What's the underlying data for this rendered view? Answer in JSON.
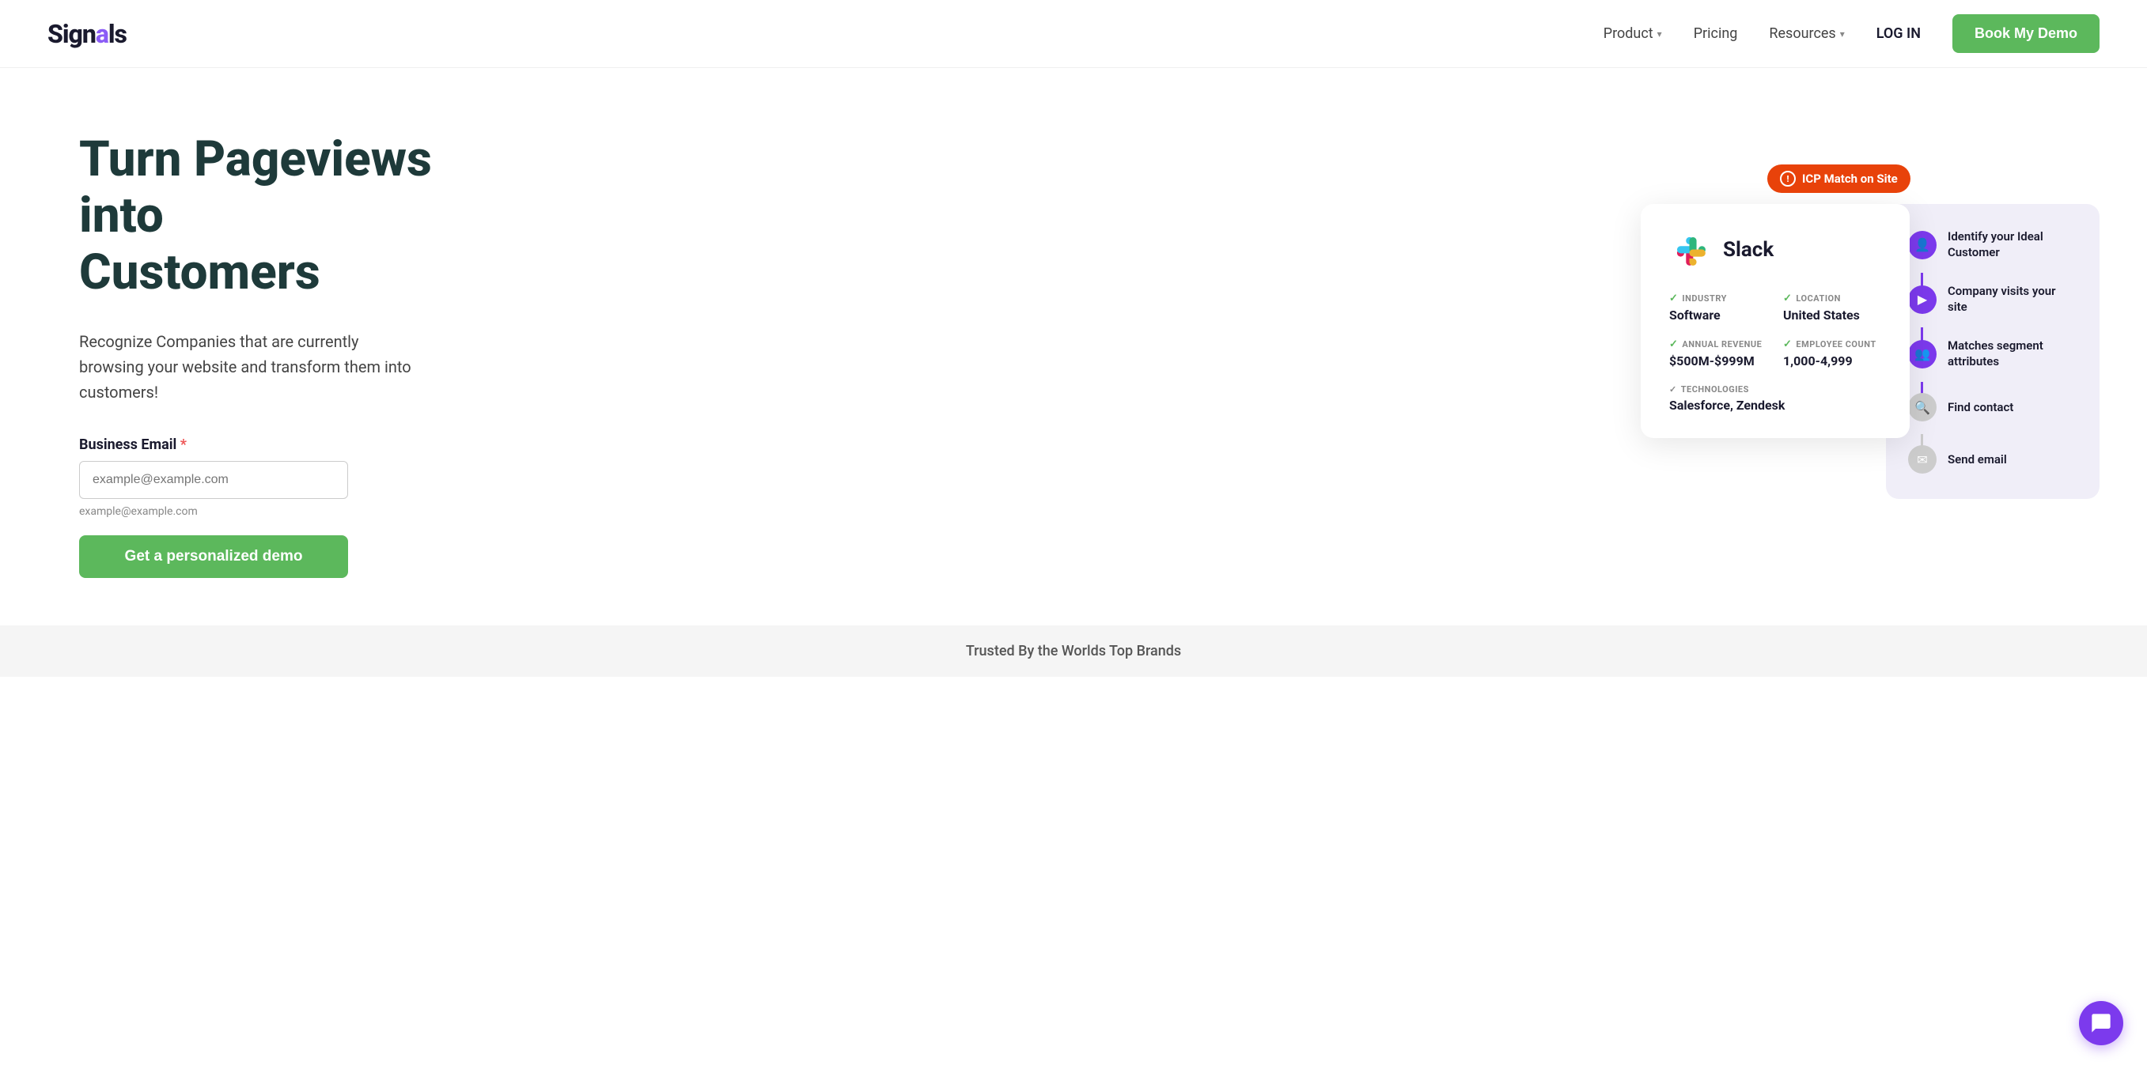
{
  "logo": {
    "text_before": "Sign",
    "text_highlight": "a",
    "text_after": "ls"
  },
  "nav": {
    "product_label": "Product",
    "pricing_label": "Pricing",
    "resources_label": "Resources",
    "login_label": "LOG IN",
    "cta_label": "Book My Demo"
  },
  "hero": {
    "heading_line1": "Turn Pageviews into",
    "heading_line2": "Customers",
    "subtext": "Recognize Companies that are currently browsing your website and transform them into customers!",
    "email_label": "Business Email",
    "email_required": "*",
    "email_placeholder": "example@example.com",
    "cta_label": "Get a personalized demo"
  },
  "icp_badge": {
    "label": "ICP Match on Site"
  },
  "company_card": {
    "name": "Slack",
    "industry_label": "INDUSTRY",
    "industry_val": "Software",
    "location_label": "LOCATION",
    "location_val": "United States",
    "revenue_label": "ANNUAL REVENUE",
    "revenue_val": "$500M-$999M",
    "employees_label": "EMPLOYEE COUNT",
    "employees_val": "1,000-4,999",
    "tech_label": "TECHNOLOGIES",
    "tech_val": "Salesforce, Zendesk"
  },
  "steps": [
    {
      "label": "Identify your Ideal Customer",
      "active": true,
      "icon": "👤"
    },
    {
      "label": "Company visits your site",
      "active": true,
      "icon": "▶"
    },
    {
      "label": "Matches segment attributes",
      "active": true,
      "icon": "👥"
    },
    {
      "label": "Find contact",
      "active": false,
      "icon": "🔍"
    },
    {
      "label": "Send email",
      "active": false,
      "icon": "✉"
    }
  ],
  "footer": {
    "text": "Trusted By the Worlds Top Brands"
  }
}
